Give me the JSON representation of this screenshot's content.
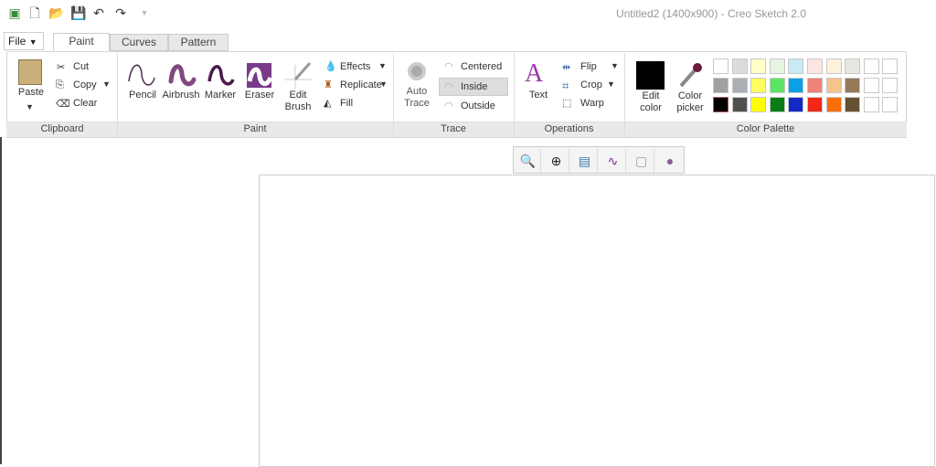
{
  "window": {
    "title": "Untitled2 (1400x900) - Creo Sketch 2.0"
  },
  "quick_access": [
    "app-icon",
    "new-icon",
    "open-icon",
    "save-icon",
    "undo-icon",
    "redo-icon",
    "customize-icon"
  ],
  "menu": {
    "file": "File"
  },
  "tabs": [
    {
      "label": "Paint",
      "active": true
    },
    {
      "label": "Curves"
    },
    {
      "label": "Pattern"
    }
  ],
  "clipboard": {
    "paste": "Paste",
    "cut": "Cut",
    "copy": "Copy",
    "clear": "Clear",
    "group": "Clipboard"
  },
  "paint": {
    "pencil": "Pencil",
    "airbrush": "Airbrush",
    "marker": "Marker",
    "eraser": "Eraser",
    "edit_brush_1": "Edit",
    "edit_brush_2": "Brush",
    "effects": "Effects",
    "replicate": "Replicate",
    "fill": "Fill",
    "group": "Paint"
  },
  "trace": {
    "auto_1": "Auto",
    "auto_2": "Trace",
    "centered": "Centered",
    "inside": "Inside",
    "outside": "Outside",
    "group": "Trace"
  },
  "operations": {
    "text": "Text",
    "flip": "Flip",
    "crop": "Crop",
    "warp": "Warp",
    "group": "Operations"
  },
  "colors": {
    "edit_1": "Edit",
    "edit_2": "color",
    "picker_1": "Color",
    "picker_2": "picker",
    "group": "Color Palette",
    "current": "#000000",
    "palette": [
      [
        "#ffffff",
        "#dcdcdc",
        "#ffffc8",
        "#e6f5e1",
        "#c8e9f5",
        "#fde6e1",
        "#fdf1dc",
        "#e6e6e1",
        "#ffffff",
        "#ffffff"
      ],
      [
        "#a0a0a0",
        "#aab0b4",
        "#ffff64",
        "#5ae664",
        "#0aa0e6",
        "#f08278",
        "#f5c38c",
        "#96785a",
        "#ffffff",
        "#ffffff"
      ],
      [
        "#000000",
        "#505050",
        "#ffff00",
        "#0a7d14",
        "#1428c8",
        "#f02814",
        "#fa6e0a",
        "#645032",
        "#ffffff",
        "#ffffff"
      ]
    ]
  },
  "canvas_tools": [
    "zoom-fit-icon",
    "zoom-region-icon",
    "fit-image-icon",
    "curve-visibility-icon",
    "frame-visibility-icon",
    "brush-preview-icon"
  ]
}
